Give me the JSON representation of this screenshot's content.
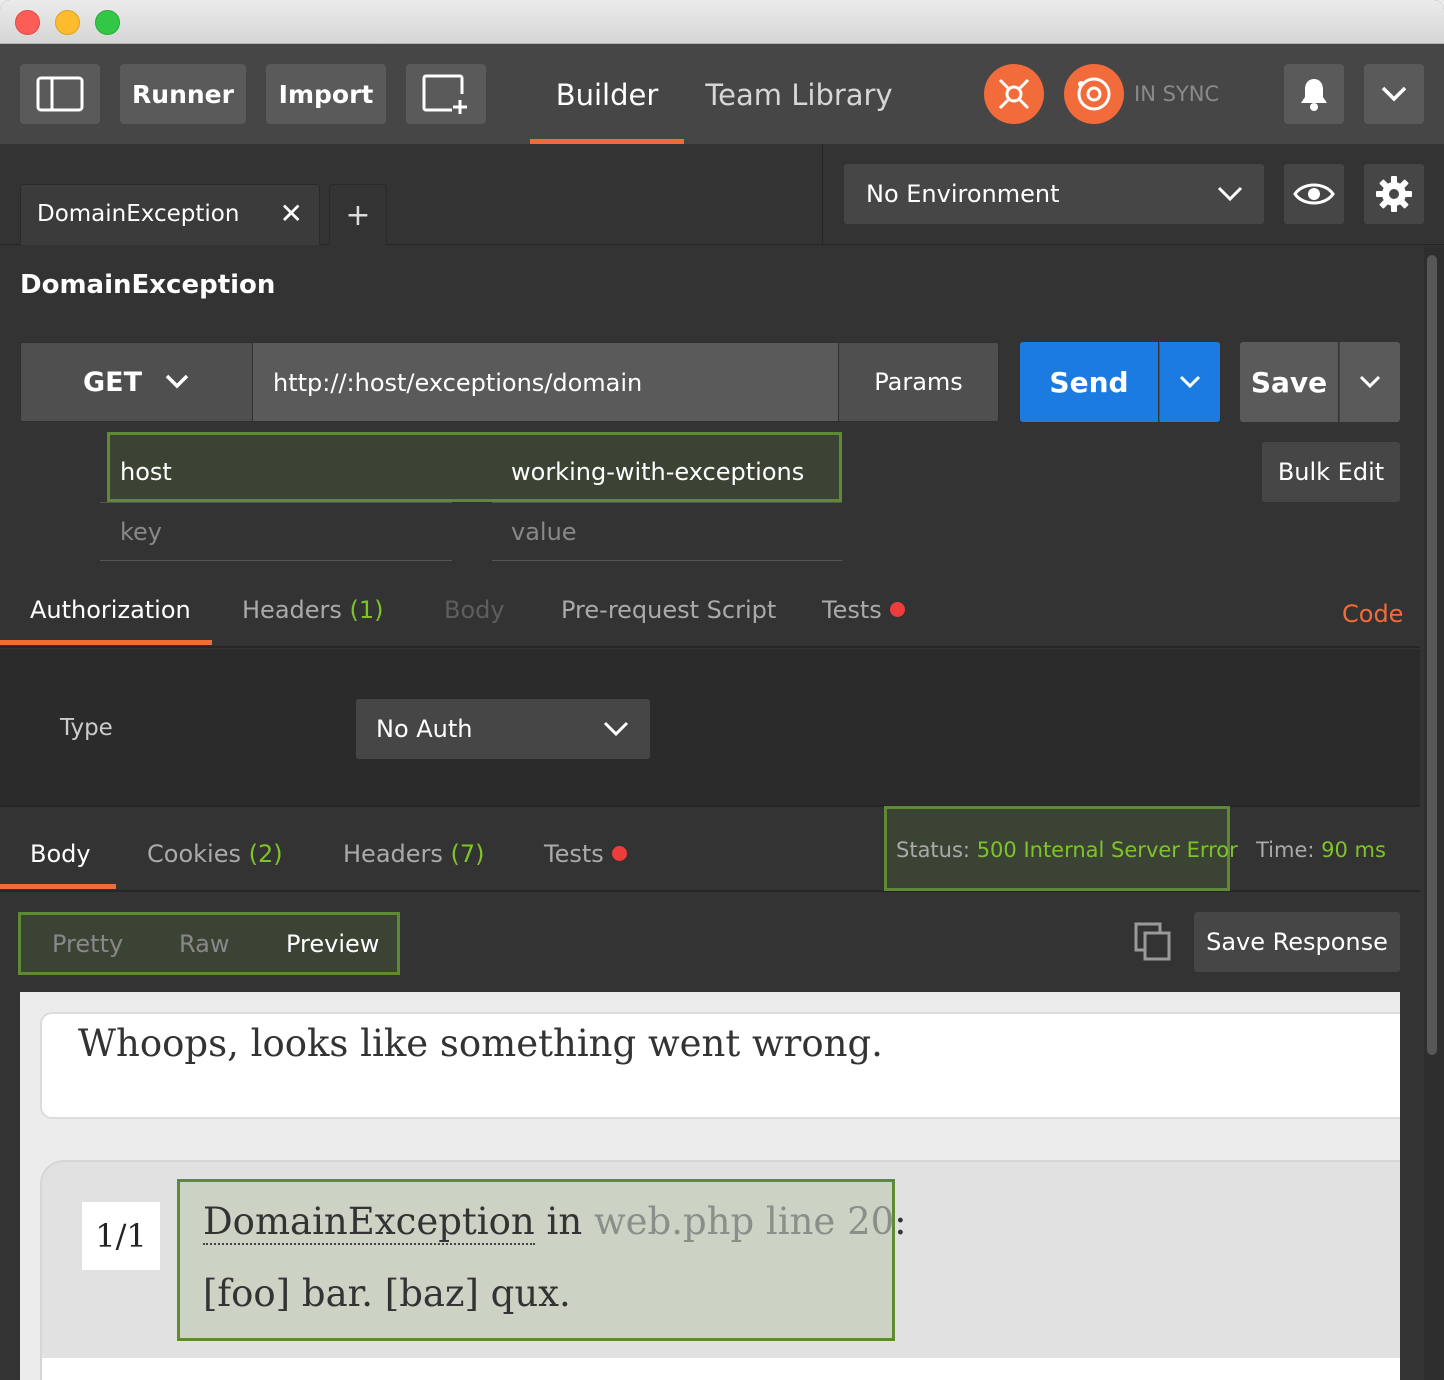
{
  "toolbar": {
    "runner": "Runner",
    "import": "Import",
    "nav_tabs": [
      "Builder",
      "Team Library"
    ],
    "sync_status": "IN SYNC"
  },
  "tabs": {
    "active_tab": "DomainException",
    "close_icon": "close-icon",
    "new_tab_icon": "plus-icon"
  },
  "environment": {
    "selected": "No Environment"
  },
  "request": {
    "title": "DomainException",
    "method": "GET",
    "url": "http://:host/exceptions/domain",
    "params_label": "Params",
    "send_label": "Send",
    "save_label": "Save",
    "bulk_edit": "Bulk Edit",
    "path_vars": [
      {
        "key": "host",
        "value": "working-with-exceptions"
      }
    ],
    "key_placeholder": "key",
    "value_placeholder": "value"
  },
  "request_tabs": {
    "authorization": "Authorization",
    "headers": "Headers",
    "headers_count": "(1)",
    "body": "Body",
    "prerequest": "Pre-request Script",
    "tests": "Tests",
    "code": "Code"
  },
  "auth": {
    "type_label": "Type",
    "selected": "No Auth"
  },
  "response_tabs": {
    "body": "Body",
    "cookies": "Cookies",
    "cookies_count": "(2)",
    "headers": "Headers",
    "headers_count": "(7)",
    "tests": "Tests",
    "status_label": "Status:",
    "status_value": "500 Internal Server Error",
    "time_label": "Time:",
    "time_value": "90 ms"
  },
  "response_format": {
    "options": [
      "Pretty",
      "Raw",
      "Preview"
    ],
    "active": "Preview",
    "save_response": "Save Response"
  },
  "preview": {
    "headline": "Whoops, looks like something went wrong.",
    "counter": "1/1",
    "exception_class": "DomainException",
    "in_word": "in",
    "location": "web.php line 20",
    "colon": ":",
    "message": "[foo] bar. [baz] qux."
  },
  "colors": {
    "accent_orange": "#f26b3a",
    "send_blue": "#1c7be0",
    "highlight_green": "#5d8a32",
    "count_green": "#7ec427",
    "dot_red": "#ec3c3c"
  }
}
